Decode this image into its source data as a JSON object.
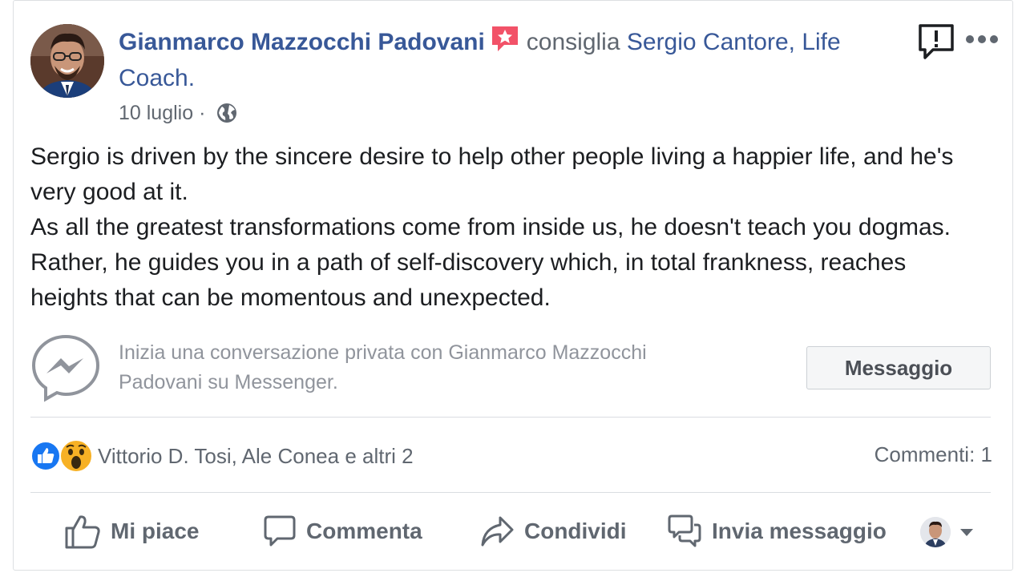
{
  "post": {
    "author": "Gianmarco Mazzocchi Padovani",
    "verb": "consiglia",
    "page_name": "Sergio Cantore, Life Coach.",
    "date": "10 luglio",
    "separator": "·",
    "privacy_icon": "globe-icon",
    "recommendation_icon": "star-badge-icon"
  },
  "content": {
    "paragraphs": [
      "Sergio is driven by the sincere desire to help other people living a happier life, and he's very good at it.",
      "As all the greatest transformations come from inside us, he doesn't teach you dogmas. Rather, he guides you in a path of self-discovery which, in total frankness, reaches heights that can be momentous and unexpected."
    ]
  },
  "messenger": {
    "prompt": "Inizia una conversazione privata con Gianmarco Mazzocchi Padovani su Messenger.",
    "button_label": "Messaggio"
  },
  "reactions": {
    "names": "Vittorio D. Tosi, Ale Conea e altri 2",
    "comments": "Commenti: 1",
    "types": [
      "like",
      "wow"
    ]
  },
  "actions": {
    "like": "Mi piace",
    "comment": "Commenta",
    "share": "Condividi",
    "send": "Invia messaggio"
  },
  "colors": {
    "link": "#385898",
    "secondary_text": "#606770",
    "badge": "#f25268",
    "like_blue": "#1877f2",
    "wow_yellow": "#f7b125"
  }
}
